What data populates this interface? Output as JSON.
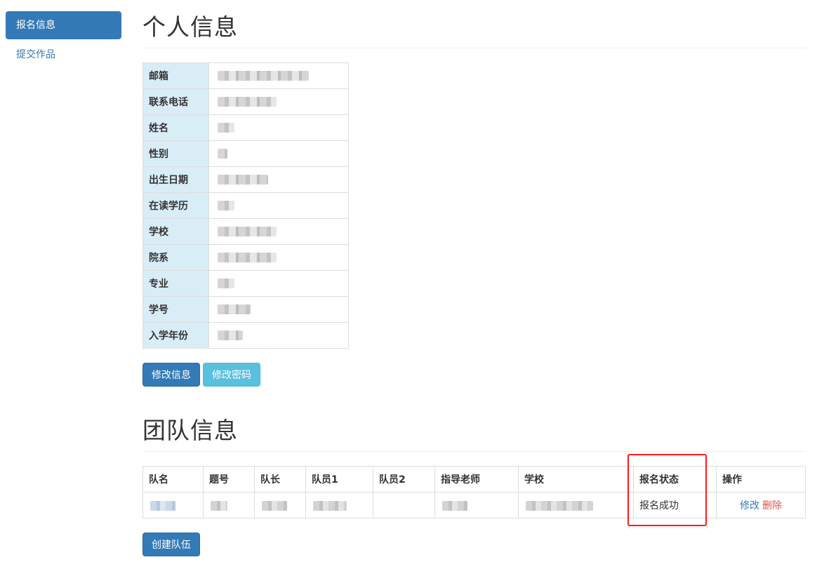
{
  "sidebar": {
    "items": [
      {
        "label": "报名信息",
        "active": true
      },
      {
        "label": "提交作品",
        "active": false
      }
    ]
  },
  "profile": {
    "title": "个人信息",
    "fields": [
      {
        "key": "邮箱"
      },
      {
        "key": "联系电话"
      },
      {
        "key": "姓名"
      },
      {
        "key": "性别"
      },
      {
        "key": "出生日期"
      },
      {
        "key": "在读学历"
      },
      {
        "key": "学校"
      },
      {
        "key": "院系"
      },
      {
        "key": "专业"
      },
      {
        "key": "学号"
      },
      {
        "key": "入学年份"
      }
    ],
    "edit_info_label": "修改信息",
    "change_password_label": "修改密码"
  },
  "team": {
    "title": "团队信息",
    "columns": [
      "队名",
      "题号",
      "队长",
      "队员1",
      "队员2",
      "指导老师",
      "学校",
      "报名状态",
      "操作"
    ],
    "row": {
      "status": "报名成功",
      "edit_label": "修改",
      "delete_label": "删除"
    },
    "create_label": "创建队伍"
  },
  "colors": {
    "primary": "#337ab7",
    "info": "#5bc0de",
    "danger": "#d9534f",
    "label_bg": "#d9edf7",
    "highlight": "#ff1a1a"
  }
}
